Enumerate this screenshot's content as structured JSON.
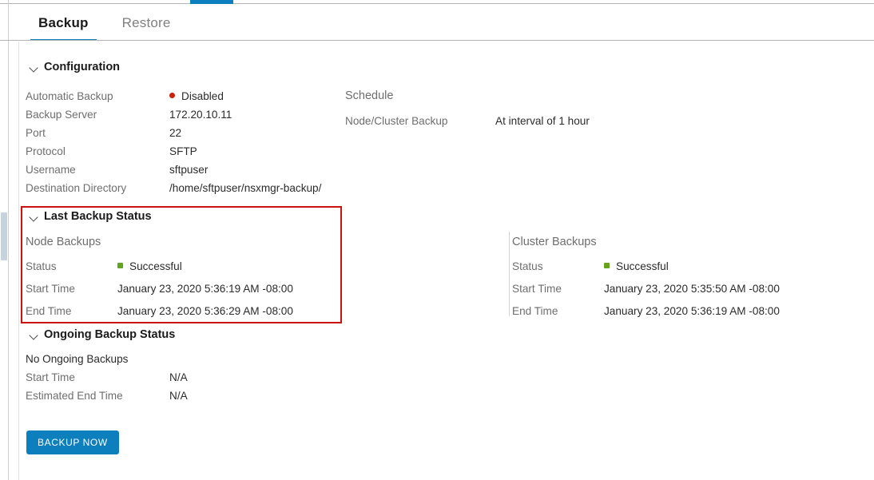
{
  "top_accent_color": "#0d7fbd",
  "tabs": [
    {
      "label": "Backup",
      "active": true
    },
    {
      "label": "Restore",
      "active": false
    }
  ],
  "configuration": {
    "heading": "Configuration",
    "left_rows": [
      {
        "label": "Automatic Backup",
        "value": "Disabled",
        "dot": "red"
      },
      {
        "label": "Backup Server",
        "value": "172.20.10.11"
      },
      {
        "label": "Port",
        "value": "22"
      },
      {
        "label": "Protocol",
        "value": "SFTP"
      },
      {
        "label": "Username",
        "value": "sftpuser"
      },
      {
        "label": "Destination Directory",
        "value": "/home/sftpuser/nsxmgr-backup/"
      }
    ],
    "right_title": "Schedule",
    "right_rows": [
      {
        "label": "Node/Cluster Backup",
        "value": "At interval of 1 hour"
      }
    ]
  },
  "last_backup_status": {
    "heading": "Last Backup Status",
    "highlight_color": "#cc1111",
    "node": {
      "title": "Node Backups",
      "status_label": "Status",
      "status_value": "Successful",
      "status_dot": "green",
      "start_label": "Start Time",
      "start_value": "January 23, 2020 5:36:19 AM -08:00",
      "end_label": "End Time",
      "end_value": "January 23, 2020 5:36:29 AM -08:00"
    },
    "cluster": {
      "title": "Cluster Backups",
      "status_label": "Status",
      "status_value": "Successful",
      "status_dot": "green",
      "start_label": "Start Time",
      "start_value": "January 23, 2020 5:35:50 AM -08:00",
      "end_label": "End Time",
      "end_value": "January 23, 2020 5:36:19 AM -08:00"
    }
  },
  "ongoing_backup_status": {
    "heading": "Ongoing Backup Status",
    "message": "No Ongoing Backups",
    "rows": [
      {
        "label": "Start Time",
        "value": "N/A"
      },
      {
        "label": "Estimated End Time",
        "value": "N/A"
      }
    ]
  },
  "actions": {
    "backup_now": "BACKUP NOW"
  }
}
